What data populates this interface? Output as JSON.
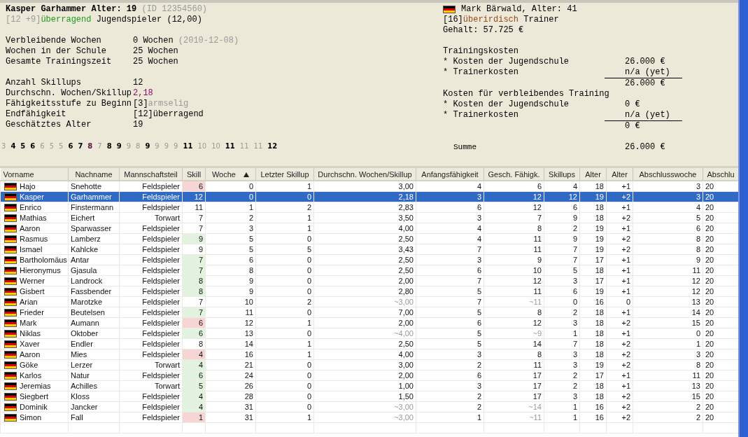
{
  "player": {
    "title": [
      {
        "text": "Kasper Garhammer Alter: 19",
        "bold": true,
        "color": "#000000"
      },
      {
        "text": " (ID 12354560)",
        "bold": false,
        "color": "#9a9a9a"
      }
    ],
    "subtitle": [
      {
        "text": "[12 +9]",
        "bold": false,
        "color": "#9a9a9a"
      },
      {
        "text": "überragend",
        "bold": false,
        "color": "#1f9a1f"
      },
      {
        "text": " Jugendspieler (12,00)",
        "bold": false,
        "color": "#000000"
      }
    ],
    "groups": [
      [
        {
          "label": "Verbleibende Wochen",
          "value": [
            {
              "text": "0 Wochen",
              "color": "#000000"
            },
            {
              "text": " (2010-12-08)",
              "color": "#9a9a9a"
            }
          ]
        },
        {
          "label": "Wochen in der Schule",
          "value": [
            {
              "text": "25 Wochen",
              "color": "#000000"
            }
          ]
        },
        {
          "label": "Gesamte Trainingszeit",
          "value": [
            {
              "text": "25 Wochen",
              "color": "#000000"
            }
          ]
        }
      ],
      [
        {
          "label": "Anzahl Skillups",
          "value": [
            {
              "text": "12",
              "color": "#000000"
            }
          ]
        },
        {
          "label": "Durchschn. Wochen/Skillup",
          "value": [
            {
              "text": "2,18",
              "color": "#8a0a6a"
            }
          ]
        },
        {
          "label": "Fähigkeitsstufe zu Beginn",
          "value": [
            {
              "text": "[3]",
              "color": "#000000"
            },
            {
              "text": "armselig",
              "color": "#9a9a9a"
            }
          ]
        },
        {
          "label": "Endfähigkeit",
          "value": [
            {
              "text": "[12]überragend",
              "color": "#000000"
            }
          ]
        },
        {
          "label": "Geschätztes Alter",
          "value": [
            {
              "text": "19",
              "color": "#000000"
            }
          ]
        }
      ]
    ],
    "progression": [
      {
        "text": "3",
        "bold": false,
        "color": "#9a9a9a"
      },
      {
        "text": "4",
        "bold": true,
        "color": "#000000"
      },
      {
        "text": "5",
        "bold": true,
        "color": "#000000"
      },
      {
        "text": "6",
        "bold": true,
        "color": "#000000"
      },
      {
        "text": "6",
        "bold": false,
        "color": "#9a9a9a"
      },
      {
        "text": "5",
        "bold": false,
        "color": "#9a9a9a"
      },
      {
        "text": "5",
        "bold": false,
        "color": "#9a9a9a"
      },
      {
        "text": "6",
        "bold": true,
        "color": "#000000"
      },
      {
        "text": "7",
        "bold": true,
        "color": "#000000"
      },
      {
        "text": "8",
        "bold": true,
        "color": "#5a1040"
      },
      {
        "text": "7",
        "bold": false,
        "color": "#9a9a9a"
      },
      {
        "text": "8",
        "bold": true,
        "color": "#000000"
      },
      {
        "text": "9",
        "bold": true,
        "color": "#000000"
      },
      {
        "text": "9",
        "bold": false,
        "color": "#9a9a9a"
      },
      {
        "text": "8",
        "bold": false,
        "color": "#9a9a9a"
      },
      {
        "text": "9",
        "bold": true,
        "color": "#000000"
      },
      {
        "text": "9",
        "bold": false,
        "color": "#9a9a9a"
      },
      {
        "text": "9",
        "bold": false,
        "color": "#9a9a9a"
      },
      {
        "text": "9",
        "bold": false,
        "color": "#9a9a9a"
      },
      {
        "text": "11",
        "bold": true,
        "color": "#000000"
      },
      {
        "text": "10",
        "bold": false,
        "color": "#9a9a9a"
      },
      {
        "text": "10",
        "bold": false,
        "color": "#9a9a9a"
      },
      {
        "text": "11",
        "bold": true,
        "color": "#000000"
      },
      {
        "text": "11",
        "bold": false,
        "color": "#9a9a9a"
      },
      {
        "text": "11",
        "bold": false,
        "color": "#9a9a9a"
      },
      {
        "text": "12",
        "bold": true,
        "color": "#000000"
      }
    ]
  },
  "trainer": {
    "name": "Mark Bärwald, Alter: 41",
    "level": [
      {
        "text": "[16]",
        "bold": false,
        "color": "#000000"
      },
      {
        "text": "überirdisch",
        "bold": false,
        "color": "#9a4a1a"
      },
      {
        "text": " Trainer",
        "bold": false,
        "color": "#000000"
      }
    ],
    "salary": "Gehalt: 57.725 €",
    "costs": [
      {
        "kind": "heading",
        "label": "Trainingskosten"
      },
      {
        "kind": "item",
        "label": "* Kosten der Jugendschule",
        "value": "26.000 €",
        "underline": false
      },
      {
        "kind": "item",
        "label": "* Trainerkosten",
        "value": "n/a (yet)",
        "underline": true
      },
      {
        "kind": "total",
        "value": "26.000 €"
      },
      {
        "kind": "heading",
        "label": "Kosten für verbleibendes Training"
      },
      {
        "kind": "item",
        "label": "* Kosten der Jugendschule",
        "value": "0 €",
        "underline": false
      },
      {
        "kind": "item",
        "label": "* Trainerkosten",
        "value": "n/a (yet)",
        "underline": true
      },
      {
        "kind": "total",
        "value": "0 €"
      },
      {
        "kind": "sum",
        "label": "Summe",
        "value": "26.000 €"
      }
    ]
  },
  "table": {
    "columns": [
      {
        "label": "Vorname",
        "sorted": false
      },
      {
        "label": "Nachname",
        "sorted": false
      },
      {
        "label": "Mannschaftsteil",
        "sorted": false
      },
      {
        "label": "Skill",
        "sorted": false
      },
      {
        "label": "Woche",
        "sorted": true
      },
      {
        "label": "Letzter Skillup",
        "sorted": false
      },
      {
        "label": "Durchschn. Wochen/Skillup",
        "sorted": false
      },
      {
        "label": "Anfangsfähigkeit",
        "sorted": false
      },
      {
        "label": "Gesch. Fähigk.",
        "sorted": false
      },
      {
        "label": "Skillups",
        "sorted": false
      },
      {
        "label": "Alter",
        "sorted": false
      },
      {
        "label": "Alter",
        "sorted": false
      },
      {
        "label": "Abschlusswoche",
        "sorted": false
      },
      {
        "label": "Abschlu",
        "sorted": false
      }
    ],
    "rows": [
      {
        "selected": false,
        "color": "#f7d5d5",
        "estimated": false,
        "cells": [
          "Hajo",
          "Snehotte",
          "Feldspieler",
          "6",
          "0",
          "1",
          "3,00",
          "4",
          "6",
          "4",
          "18",
          "+1",
          "3",
          "20"
        ]
      },
      {
        "selected": true,
        "estimated": false,
        "cells": [
          "Kasper",
          "Garhammer",
          "Feldspieler",
          "12",
          "0",
          "0",
          "2,18",
          "3",
          "12",
          "12",
          "19",
          "+2",
          "3",
          "20"
        ]
      },
      {
        "selected": false,
        "estimated": false,
        "cells": [
          "Enrico",
          "Finstermann",
          "Feldspieler",
          "11",
          "1",
          "2",
          "2,83",
          "6",
          "12",
          "6",
          "18",
          "+1",
          "4",
          "20"
        ]
      },
      {
        "selected": false,
        "estimated": false,
        "cells": [
          "Mathias",
          "Eichert",
          "Torwart",
          "7",
          "2",
          "1",
          "3,50",
          "3",
          "7",
          "9",
          "18",
          "+2",
          "5",
          "20"
        ]
      },
      {
        "selected": false,
        "estimated": false,
        "cells": [
          "Aaron",
          "Sparwasser",
          "Feldspieler",
          "7",
          "3",
          "1",
          "4,00",
          "4",
          "8",
          "2",
          "19",
          "+1",
          "6",
          "20"
        ]
      },
      {
        "selected": false,
        "color": "#e2f3df",
        "estimated": false,
        "cells": [
          "Rasmus",
          "Lamberz",
          "Feldspieler",
          "9",
          "5",
          "0",
          "2,50",
          "4",
          "11",
          "9",
          "19",
          "+2",
          "8",
          "20"
        ]
      },
      {
        "selected": false,
        "estimated": false,
        "cells": [
          "Ismael",
          "Kahlcke",
          "Feldspieler",
          "9",
          "5",
          "5",
          "3,43",
          "7",
          "11",
          "7",
          "19",
          "+2",
          "8",
          "20"
        ]
      },
      {
        "selected": false,
        "color": "#e2f3df",
        "estimated": false,
        "cells": [
          "Bartholomäus",
          "Antar",
          "Feldspieler",
          "7",
          "6",
          "0",
          "2,50",
          "3",
          "9",
          "7",
          "17",
          "+1",
          "9",
          "20"
        ]
      },
      {
        "selected": false,
        "color": "#e2f3df",
        "estimated": false,
        "cells": [
          "Hieronymus",
          "Gjasula",
          "Feldspieler",
          "7",
          "8",
          "0",
          "2,50",
          "6",
          "10",
          "5",
          "18",
          "+1",
          "11",
          "20"
        ]
      },
      {
        "selected": false,
        "color": "#e2f3df",
        "estimated": false,
        "cells": [
          "Werner",
          "Landrock",
          "Feldspieler",
          "8",
          "9",
          "0",
          "2,00",
          "7",
          "12",
          "3",
          "17",
          "+1",
          "12",
          "20"
        ]
      },
      {
        "selected": false,
        "color": "#e2f3df",
        "estimated": false,
        "cells": [
          "Gisbert",
          "Fassbender",
          "Feldspieler",
          "8",
          "9",
          "0",
          "2,80",
          "5",
          "11",
          "6",
          "19",
          "+1",
          "12",
          "20"
        ]
      },
      {
        "selected": false,
        "estimated": true,
        "cells": [
          "Arian",
          "Marotzke",
          "Feldspieler",
          "7",
          "10",
          "2",
          "~3,00",
          "7",
          "~11",
          "0",
          "16",
          "0",
          "13",
          "20"
        ]
      },
      {
        "selected": false,
        "color": "#e2f3df",
        "estimated": false,
        "cells": [
          "Frieder",
          "Beutelsen",
          "Feldspieler",
          "7",
          "11",
          "0",
          "7,00",
          "5",
          "8",
          "2",
          "18",
          "+1",
          "14",
          "20"
        ]
      },
      {
        "selected": false,
        "color": "#f7d5d5",
        "estimated": false,
        "cells": [
          "Mark",
          "Aumann",
          "Feldspieler",
          "6",
          "12",
          "1",
          "2,00",
          "6",
          "12",
          "3",
          "18",
          "+2",
          "15",
          "20"
        ]
      },
      {
        "selected": false,
        "color": "#e2f3df",
        "estimated": true,
        "cells": [
          "Niklas",
          "Oktober",
          "Feldspieler",
          "6",
          "13",
          "0",
          "~4,00",
          "5",
          "~9",
          "1",
          "18",
          "+1",
          "0",
          "20"
        ]
      },
      {
        "selected": false,
        "estimated": false,
        "cells": [
          "Xaver",
          "Endler",
          "Feldspieler",
          "8",
          "14",
          "1",
          "2,50",
          "5",
          "14",
          "7",
          "18",
          "+2",
          "1",
          "20"
        ]
      },
      {
        "selected": false,
        "color": "#f7d5d5",
        "estimated": false,
        "cells": [
          "Aaron",
          "Mies",
          "Feldspieler",
          "4",
          "16",
          "1",
          "4,00",
          "3",
          "8",
          "3",
          "18",
          "+2",
          "3",
          "20"
        ]
      },
      {
        "selected": false,
        "color": "#e2f3df",
        "estimated": false,
        "cells": [
          "Göke",
          "Lerzer",
          "Torwart",
          "4",
          "21",
          "0",
          "3,00",
          "2",
          "11",
          "3",
          "19",
          "+2",
          "8",
          "20"
        ]
      },
      {
        "selected": false,
        "color": "#e2f3df",
        "estimated": false,
        "cells": [
          "Karlos",
          "Natur",
          "Feldspieler",
          "6",
          "24",
          "0",
          "2,00",
          "6",
          "17",
          "2",
          "17",
          "+1",
          "11",
          "20"
        ]
      },
      {
        "selected": false,
        "color": "#e2f3df",
        "estimated": false,
        "cells": [
          "Jeremias",
          "Achilles",
          "Torwart",
          "5",
          "26",
          "0",
          "1,00",
          "3",
          "17",
          "2",
          "18",
          "+1",
          "13",
          "20"
        ]
      },
      {
        "selected": false,
        "color": "#e2f3df",
        "estimated": false,
        "cells": [
          "Siegbert",
          "Kloss",
          "Feldspieler",
          "4",
          "28",
          "0",
          "1,50",
          "2",
          "17",
          "3",
          "18",
          "+2",
          "15",
          "20"
        ]
      },
      {
        "selected": false,
        "color": "#e2f3df",
        "estimated": true,
        "cells": [
          "Dominik",
          "Jancker",
          "Feldspieler",
          "4",
          "31",
          "0",
          "~3,00",
          "2",
          "~14",
          "1",
          "16",
          "+2",
          "2",
          "20"
        ]
      },
      {
        "selected": false,
        "color": "#f7d5d5",
        "estimated": true,
        "cells": [
          "Simon",
          "Fall",
          "Feldspieler",
          "1",
          "31",
          "1",
          "~3,00",
          "1",
          "~11",
          "1",
          "16",
          "+2",
          "2",
          "20"
        ]
      }
    ]
  }
}
